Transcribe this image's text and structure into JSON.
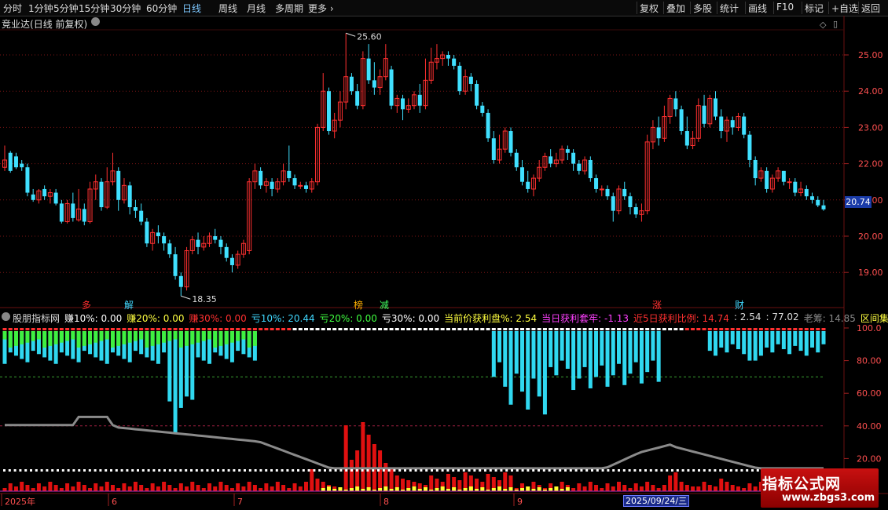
{
  "toolbar": {
    "periods": [
      "分时",
      "1分钟",
      "5分钟",
      "15分钟",
      "30分钟",
      "60分钟",
      "日线",
      "周线",
      "月线",
      "多周期",
      "更多 ›"
    ],
    "active_period": "日线",
    "right": [
      "复权",
      "叠加",
      "多股",
      "统计",
      "画线",
      "F10",
      "标记",
      "+自选",
      "返回"
    ]
  },
  "stock": {
    "name": "竞业达",
    "mode": "(日线 前复权)"
  },
  "price_axis": {
    "labels": [
      "25.00",
      "24.00",
      "23.00",
      "22.00",
      "21.00",
      "20.00",
      "19.00"
    ],
    "current": "20.74"
  },
  "annotations": {
    "high": "25.60",
    "low": "18.35"
  },
  "signal_labels": [
    {
      "text": "多",
      "color": "#ff3030"
    },
    {
      "text": "解",
      "color": "#40d8ff"
    },
    {
      "text": "榜",
      "color": "#ffb000"
    },
    {
      "text": "减",
      "color": "#40ff60"
    },
    {
      "text": "涨",
      "color": "#ff3030"
    },
    {
      "text": "财",
      "color": "#40d8ff"
    }
  ],
  "indicator": {
    "name": "股朋指标网",
    "items": [
      {
        "text": "赚10%: 0.00",
        "color": "#ffffff"
      },
      {
        "text": "赚20%: 0.00",
        "color": "#ffff40"
      },
      {
        "text": "赚30%: 0.00",
        "color": "#ff3030"
      },
      {
        "text": "亏10%: 20.44",
        "color": "#40d8ff"
      },
      {
        "text": "亏20%: 0.00",
        "color": "#40ff40"
      },
      {
        "text": "亏30%: 0.00",
        "color": "#ffffff"
      },
      {
        "text": "当前价获利盘%: 2.54",
        "color": "#ffff40"
      },
      {
        "text": "当日获利套牢: -1.13",
        "color": "#ff40ff"
      },
      {
        "text": "近5日获利比例: 14.74",
        "color": "#ff3030"
      },
      {
        "text": ": 2.54",
        "color": "#dddddd"
      },
      {
        "text": ": 77.02",
        "color": "#dddddd"
      },
      {
        "text": "老筹: 14.85",
        "color": "#888888"
      },
      {
        "text": "区间集中度",
        "color": "#ffff40"
      }
    ]
  },
  "ind_axis": [
    "100.0",
    "80.00",
    "60.00",
    "40.00",
    "20.00"
  ],
  "date_axis": [
    "2025年",
    "6",
    "7",
    "8",
    "9"
  ],
  "date_tag": "2025/09/24/三",
  "watermark": {
    "line1": "指标公式网",
    "line2": "www.zbgs3.com"
  },
  "colors": {
    "up": "#ff3030",
    "down": "#40e0ff",
    "grid": "#7a1515"
  }
}
